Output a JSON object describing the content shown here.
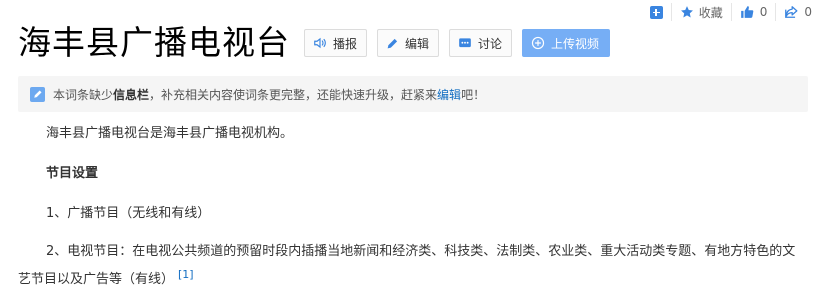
{
  "toolbar": {
    "add_icon": "plus-square-icon",
    "favorite_label": "收藏",
    "like_count": "0",
    "share_count": "0",
    "accent": "#3a85e0"
  },
  "title": "海丰县广播电视台",
  "buttons": {
    "broadcast": "播报",
    "edit": "编辑",
    "discuss": "讨论",
    "upload_video": "上传视频"
  },
  "notice": {
    "text_1": "本词条缺少",
    "bold": "信息栏",
    "text_2": "，补充相关内容使词条更完整，还能快速升级，赶紧来",
    "link": "编辑",
    "text_3": "吧！"
  },
  "content": {
    "intro": "海丰县广播电视台是海丰县广播电视机构。",
    "section_heading": "节目设置",
    "item1": "1、广播节目（无线和有线）",
    "item2": "2、电视节目：在电视公共频道的预留时段内插播当地新闻和经济类、科技类、法制类、农业类、重大活动类专题、有地方特色的文艺节目以及广告等（有线）",
    "ref": "[1]"
  }
}
